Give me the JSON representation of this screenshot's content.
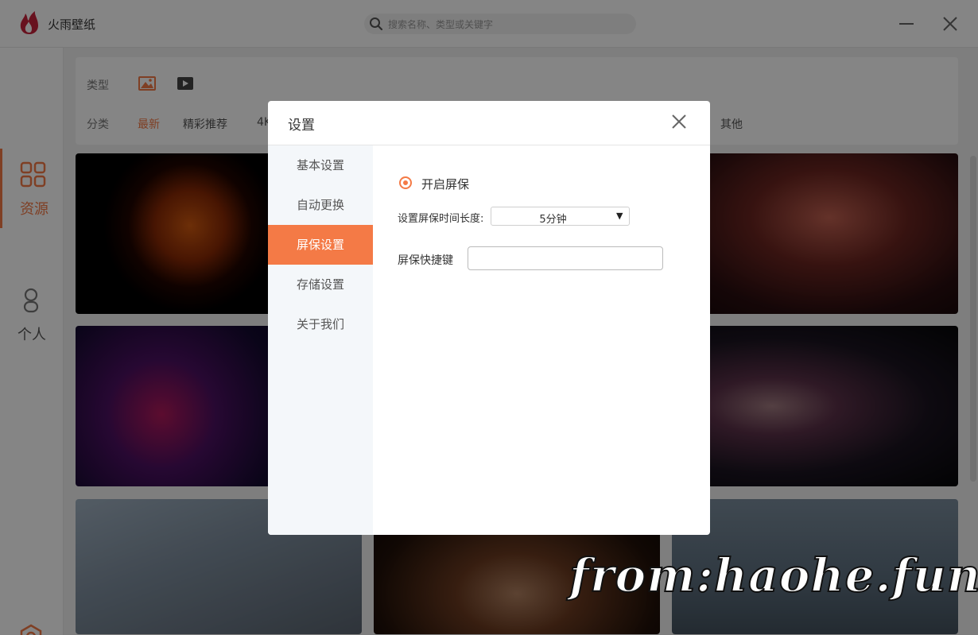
{
  "app": {
    "title": "火雨壁纸",
    "accent_color": "#f47a46",
    "search_placeholder": "搜索名称、类型或关键字"
  },
  "sidebar": {
    "items": [
      {
        "label": "资源",
        "icon": "grid-icon",
        "active": true
      },
      {
        "label": "个人",
        "icon": "person-icon",
        "active": false
      }
    ],
    "bottom_icon": "settings-hexagon-icon"
  },
  "filters": {
    "type_label": "类型",
    "type_icons": [
      "image-icon",
      "video-icon"
    ],
    "category_label": "分类",
    "categories": [
      "最新",
      "精彩推荐",
      "4K",
      "其他"
    ],
    "active_category": "最新"
  },
  "dialog": {
    "title": "设置",
    "menu": [
      "基本设置",
      "自动更换",
      "屏保设置",
      "存储设置",
      "关于我们"
    ],
    "active_menu": "屏保设置",
    "screensaver": {
      "enable_label": "开启屏保",
      "enabled": true,
      "duration_label": "设置屏保时间长度:",
      "duration_value": "5分钟",
      "hotkey_label": "屏保快捷键",
      "hotkey_value": ""
    }
  },
  "watermark": "from:haohe.fun"
}
